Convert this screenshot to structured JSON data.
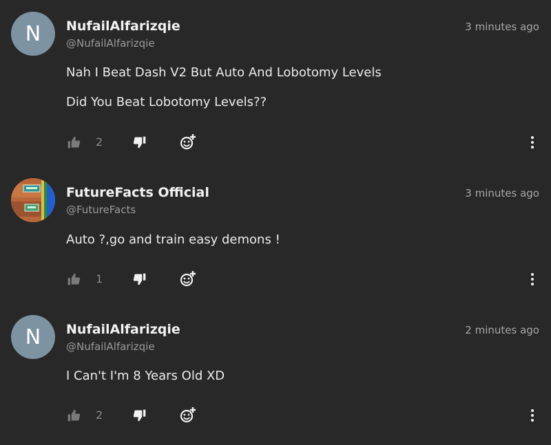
{
  "colors": {
    "background": "#282828",
    "avatar_default": "#7d93a1",
    "text_primary": "#ececec",
    "text_secondary": "#9a9a9a"
  },
  "comments": [
    {
      "avatar_letter": "N",
      "author": "NufailAlfarizqie",
      "handle": "@NufailAlfarizqie",
      "time": "3 minutes ago",
      "lines": [
        "Nah I Beat Dash V2 But Auto And Lobotomy Levels",
        "Did You Beat Lobotomy Levels??"
      ],
      "likes": "2"
    },
    {
      "avatar_letter": "",
      "avatar_icon": "game-thumbnail-avatar",
      "author": "FutureFacts Official",
      "handle": "@FutureFacts",
      "time": "3 minutes ago",
      "lines": [
        "Auto ?,go and train easy demons !"
      ],
      "likes": "1"
    },
    {
      "avatar_letter": "N",
      "author": "NufailAlfarizqie",
      "handle": "@NufailAlfarizqie",
      "time": "2 minutes ago",
      "lines": [
        "I Can't I'm 8 Years Old XD"
      ],
      "likes": "2"
    }
  ]
}
